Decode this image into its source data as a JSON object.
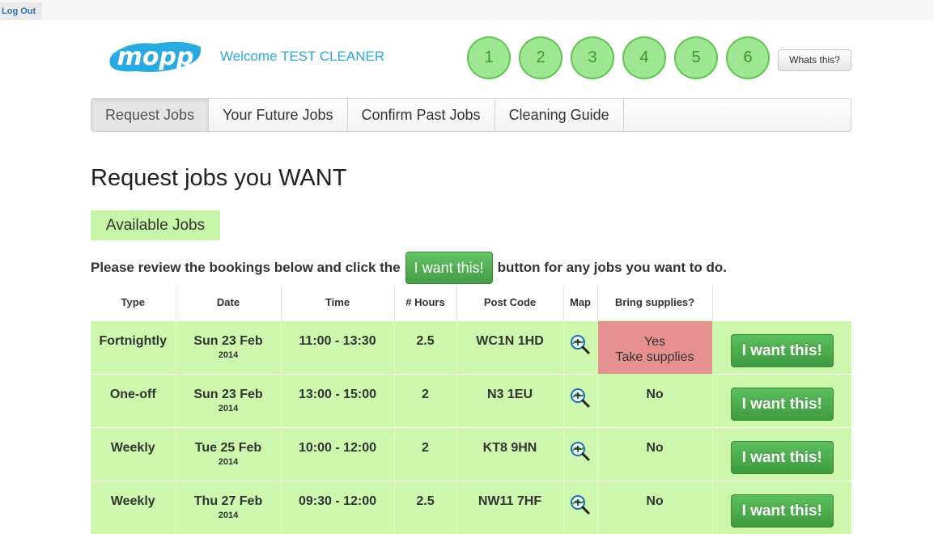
{
  "topbar": {
    "logout_label": "Log Out"
  },
  "header": {
    "logo_text": "mopp",
    "welcome": "Welcome TEST CLEANER",
    "steps": [
      "1",
      "2",
      "3",
      "4",
      "5",
      "6"
    ],
    "whats_this": "Whats this?"
  },
  "nav": {
    "tabs": [
      {
        "label": "Request Jobs"
      },
      {
        "label": "Your Future Jobs"
      },
      {
        "label": "Confirm Past Jobs"
      },
      {
        "label": "Cleaning Guide"
      }
    ],
    "active_index": 0
  },
  "main": {
    "title": "Request jobs you WANT",
    "section_label": "Available Jobs",
    "instruction_before": "Please review the bookings below and click the",
    "instruction_button": "I want this!",
    "instruction_after": "button for any jobs you want to do."
  },
  "table": {
    "headers": [
      "Type",
      "Date",
      "Time",
      "# Hours",
      "Post Code",
      "Map",
      "Bring supplies?",
      ""
    ],
    "rows": [
      {
        "type": "Fortnightly",
        "date": "Sun 23 Feb",
        "year": "2014",
        "time": "11:00 - 13:30",
        "hours": "2.5",
        "postcode": "WC1N 1HD",
        "supplies": "Yes",
        "supplies_note": "Take supplies",
        "action": "I want this!"
      },
      {
        "type": "One-off",
        "date": "Sun 23 Feb",
        "year": "2014",
        "time": "13:00 - 15:00",
        "hours": "2",
        "postcode": "N3 1EU",
        "supplies": "No",
        "supplies_note": "",
        "action": "I want this!"
      },
      {
        "type": "Weekly",
        "date": "Tue 25 Feb",
        "year": "2014",
        "time": "10:00 - 12:00",
        "hours": "2",
        "postcode": "KT8 9HN",
        "supplies": "No",
        "supplies_note": "",
        "action": "I want this!"
      },
      {
        "type": "Weekly",
        "date": "Thu 27 Feb",
        "year": "2014",
        "time": "09:30 - 12:00",
        "hours": "2.5",
        "postcode": "NW11 7HF",
        "supplies": "No",
        "supplies_note": "",
        "action": "I want this!"
      }
    ]
  },
  "icons": {
    "map": "map-zoom-icon"
  },
  "colors": {
    "accent_blue": "#29aae1",
    "row_green": "#ccf7ac",
    "supplies_red": "#e79090",
    "button_green": "#4cae4c"
  }
}
